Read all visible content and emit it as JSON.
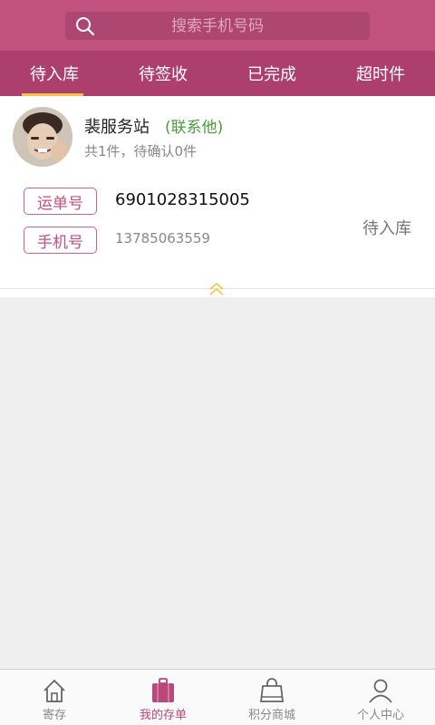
{
  "search": {
    "placeholder": "搜索手机号码"
  },
  "tabs": [
    {
      "label": "待入库",
      "active": true
    },
    {
      "label": "待签收",
      "active": false
    },
    {
      "label": "已完成",
      "active": false
    },
    {
      "label": "超时件",
      "active": false
    }
  ],
  "card": {
    "station": "裴服务站",
    "contact": "(联系他)",
    "summary": "共1件，待确认0件",
    "waybill_tag": "运单号",
    "waybill_value": "6901028315005",
    "phone_tag": "手机号",
    "phone_value": "13785063559",
    "status": "待入库"
  },
  "bottom_nav": [
    {
      "label": "寄存",
      "icon": "home-icon",
      "active": false
    },
    {
      "label": "我的存单",
      "icon": "bag-icon",
      "active": true
    },
    {
      "label": "积分商城",
      "icon": "shopping-bag-icon",
      "active": false
    },
    {
      "label": "个人中心",
      "icon": "person-icon",
      "active": false
    }
  ],
  "colors": {
    "header": "#c1517f",
    "tabs": "#ad3f6e",
    "tab_indicator": "#f2c34a",
    "accent": "#c14f82",
    "contact_green": "#4a9a3a"
  }
}
